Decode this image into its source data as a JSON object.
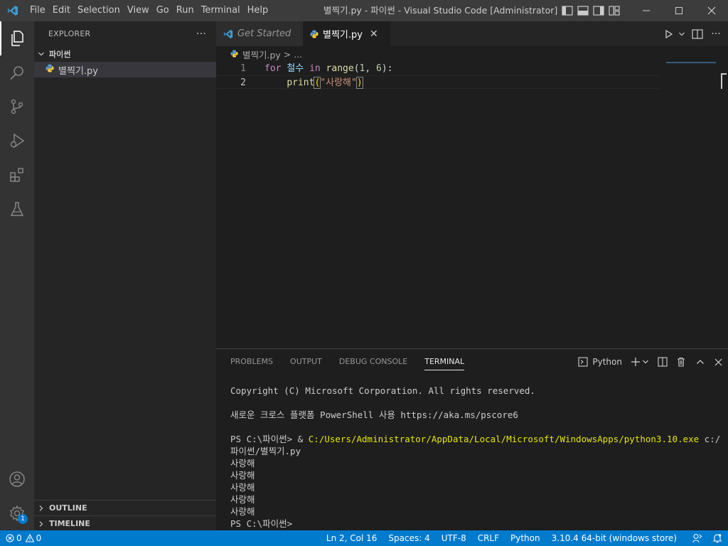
{
  "menu": [
    "File",
    "Edit",
    "Selection",
    "View",
    "Go",
    "Run",
    "Terminal",
    "Help"
  ],
  "window_title": "별찍기.py - 파이썬 - Visual Studio Code [Administrator]",
  "explorer": {
    "header": "EXPLORER",
    "more": "···",
    "folder": "파이썬",
    "file": "별찍기.py",
    "outline": "OUTLINE",
    "timeline": "TIMELINE"
  },
  "tabs": [
    {
      "label": "Get Started"
    },
    {
      "label": "별찍기.py",
      "close": "✕"
    }
  ],
  "breadcrumb": {
    "file": "별찍기.py",
    "sep": " > ...",
    "more": ""
  },
  "editor": {
    "lines": [
      {
        "num": "1",
        "kw": "for",
        "var": "철수",
        "in": "in",
        "fn": "range",
        "open": "(",
        "n1": "1",
        "comma": ", ",
        "n2": "6",
        "close": "):"
      },
      {
        "num": "2",
        "fn": "print",
        "open": "(",
        "str": "\"사랑해\"",
        "close": ")"
      }
    ]
  },
  "panel": {
    "tabs": [
      "PROBLEMS",
      "OUTPUT",
      "DEBUG CONSOLE",
      "TERMINAL"
    ],
    "terminal_name": "Python",
    "lines": [
      "Copyright (C) Microsoft Corporation. All rights reserved.",
      "",
      "새로운 크로스 플랫폼 PowerShell 사용 https://aka.ms/pscore6",
      "",
      "__CMD__",
      "사랑해",
      "사랑해",
      "사랑해",
      "사랑해",
      "사랑해",
      "PS C:\\파이썬>"
    ],
    "cmd_prompt": "PS C:\\파이썬> & ",
    "cmd_exe": "C:/Users/Administrator/AppData/Local/Microsoft/WindowsApps/python3.10.exe",
    "cmd_arg": " c:/파이썬/별찍기.py"
  },
  "status": {
    "errors": "0",
    "warnings": "0",
    "position": "Ln 2, Col 16",
    "spaces": "Spaces: 4",
    "encoding": "UTF-8",
    "eol": "CRLF",
    "language": "Python",
    "interpreter": "3.10.4 64-bit (windows store)"
  },
  "activity_badge": "1",
  "colors": {
    "accent": "#007acc",
    "titlebar": "#3c3c3c",
    "activitybar": "#333333",
    "sidebar": "#252526",
    "editor": "#1e1e1e"
  }
}
